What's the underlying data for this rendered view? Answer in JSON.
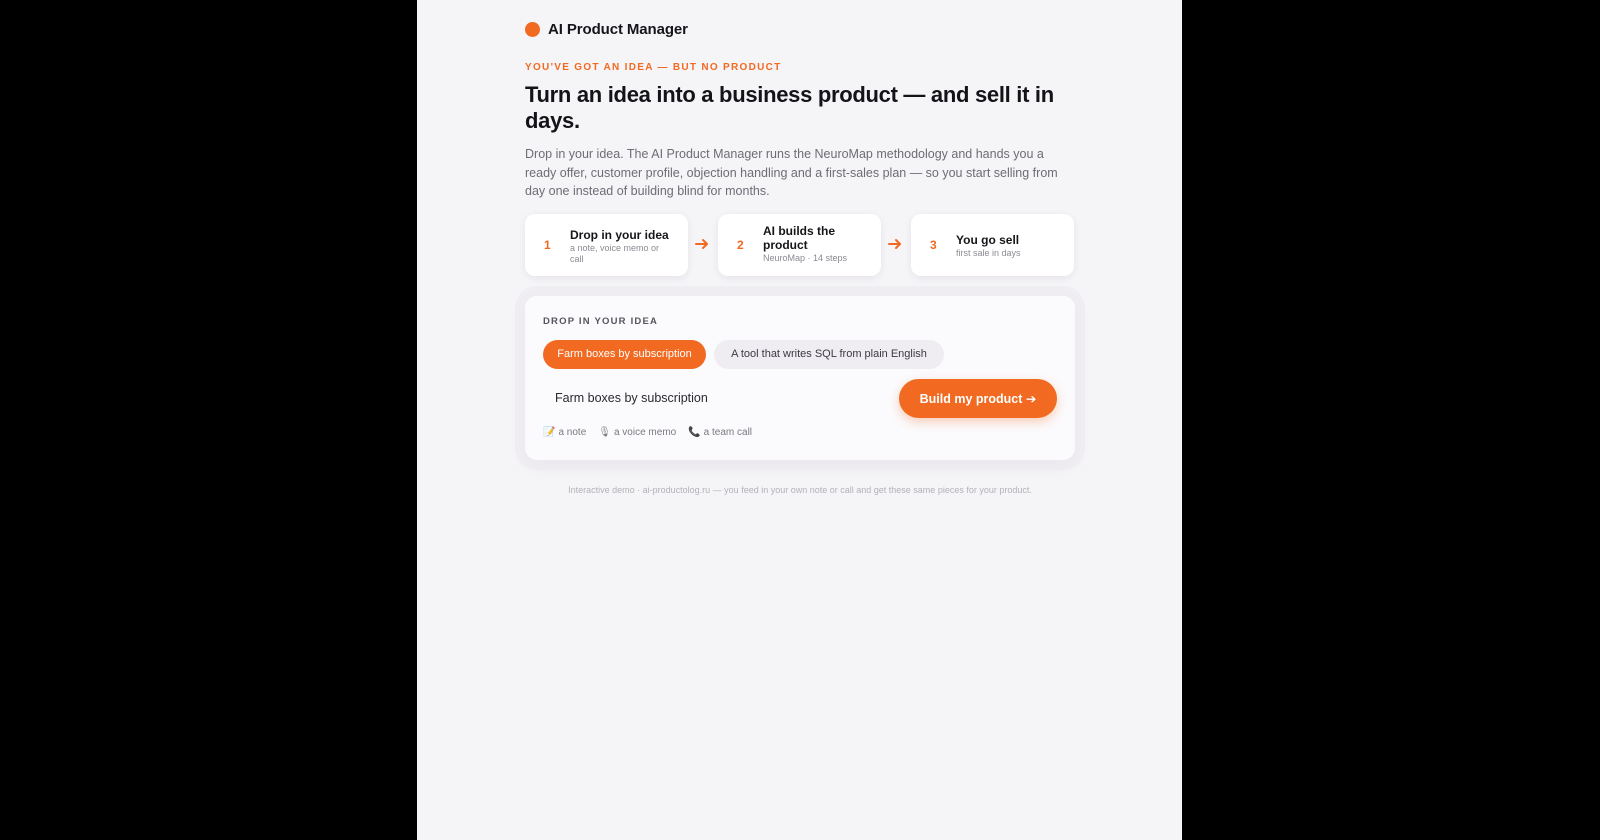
{
  "brand": {
    "name": "AI Product Manager",
    "accent": "#f26a21"
  },
  "hero": {
    "eyebrow": "YOU'VE GOT AN IDEA — BUT NO PRODUCT",
    "headline": "Turn an idea into a business product — and sell it in days.",
    "lead": "Drop in your idea. The AI Product Manager runs the NeuroMap methodology and hands you a ready offer, customer profile, objection handling and a first-sales plan — so you start selling from day one instead of building blind for months."
  },
  "steps": [
    {
      "number": "1",
      "title": "Drop in your idea",
      "subtitle": "a note, voice memo or call"
    },
    {
      "number": "2",
      "title": "AI builds the product",
      "subtitle": "NeuroMap · 14 steps"
    },
    {
      "number": "3",
      "title": "You go sell",
      "subtitle": "first sale in days"
    }
  ],
  "step_arrow_icon": "arrow-right-icon",
  "idea_card": {
    "label": "DROP IN YOUR IDEA",
    "chips": [
      {
        "label": "Farm boxes by subscription",
        "selected": true
      },
      {
        "label": "A tool that writes SQL from plain English",
        "selected": false
      }
    ],
    "input": {
      "value": "Farm boxes by subscription",
      "placeholder": ""
    },
    "build_button": "Build my product ➔",
    "sources": [
      {
        "icon": "📝",
        "icon_name": "memo-icon",
        "label": "a note"
      },
      {
        "icon": "🎙",
        "icon_name": "microphone-icon",
        "label": "a voice memo"
      },
      {
        "icon": "📞",
        "icon_name": "phone-icon",
        "label": "a team call"
      }
    ]
  },
  "footer": {
    "note": "Interactive demo · ai-productolog.ru — you feed in your own note or call and get these same pieces for your product."
  }
}
